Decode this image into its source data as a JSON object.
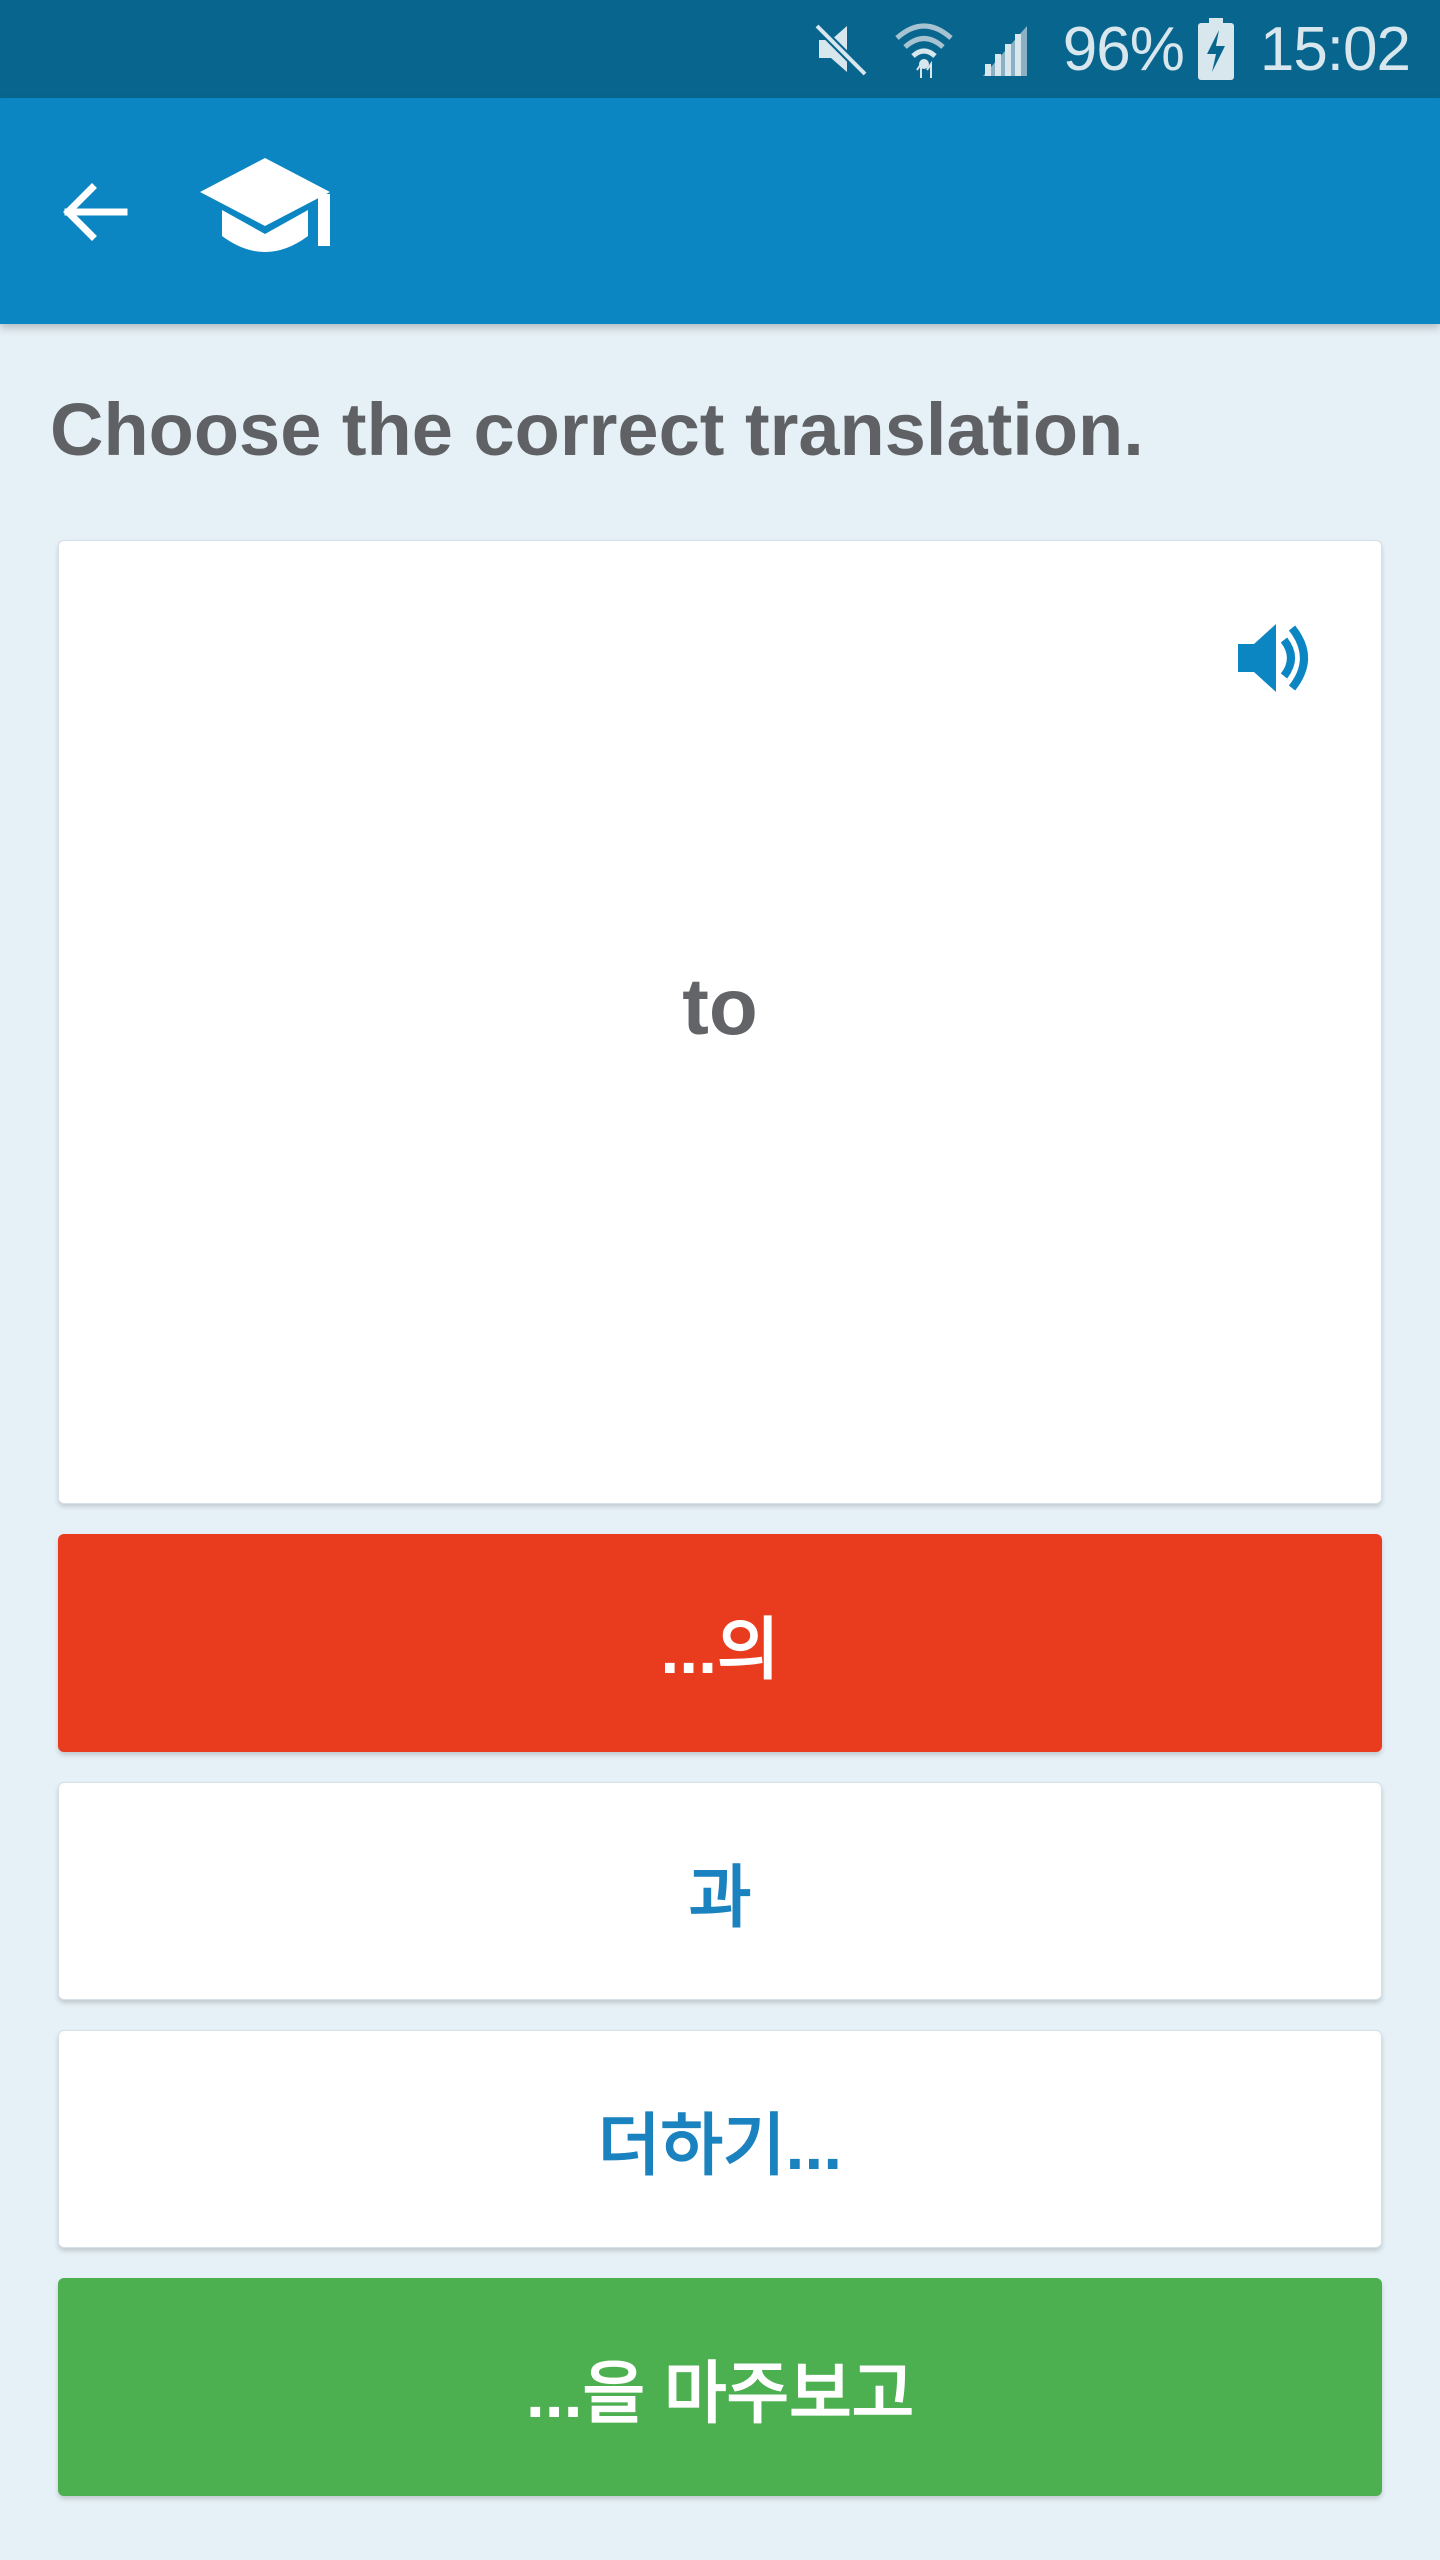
{
  "status_bar": {
    "battery_percent": "96%",
    "time": "15:02",
    "icons": [
      "mute-icon",
      "wifi-icon",
      "signal-icon",
      "battery-charging-icon"
    ]
  },
  "app_bar": {
    "back_icon": "arrow-left-icon",
    "logo_icon": "graduation-cap-icon",
    "color": "#0b86c2"
  },
  "quiz": {
    "instruction": "Choose the correct translation.",
    "word": "to",
    "audio_icon": "speaker-icon"
  },
  "answers": [
    {
      "label": "...의",
      "state": "incorrect",
      "color": "#e93c1f"
    },
    {
      "label": "과",
      "state": "neutral",
      "color": "#ffffff"
    },
    {
      "label": "더하기...",
      "state": "neutral",
      "color": "#ffffff"
    },
    {
      "label": "...을 마주보고",
      "state": "correct",
      "color": "#4caf50"
    }
  ]
}
